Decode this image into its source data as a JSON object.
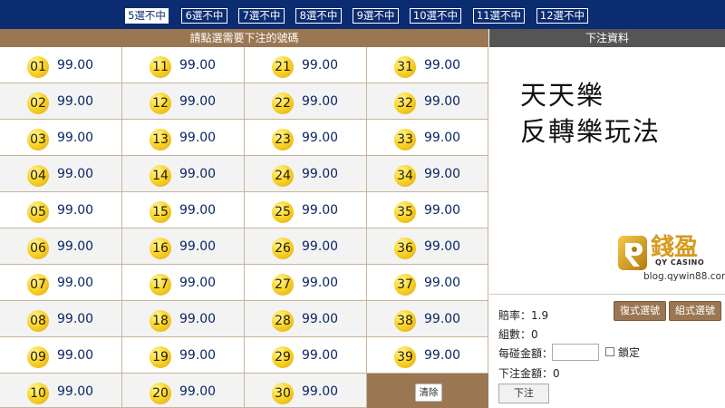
{
  "tabs": [
    {
      "label": "5選不中",
      "active": true
    },
    {
      "label": "6選不中",
      "active": false
    },
    {
      "label": "7選不中",
      "active": false
    },
    {
      "label": "8選不中",
      "active": false
    },
    {
      "label": "9選不中",
      "active": false
    },
    {
      "label": "10選不中",
      "active": false
    },
    {
      "label": "11選不中",
      "active": false
    },
    {
      "label": "12選不中",
      "active": false
    }
  ],
  "left_header": "請點選需要下注的號碼",
  "numbers": [
    {
      "num": "01",
      "odds": "99.00"
    },
    {
      "num": "02",
      "odds": "99.00"
    },
    {
      "num": "03",
      "odds": "99.00"
    },
    {
      "num": "04",
      "odds": "99.00"
    },
    {
      "num": "05",
      "odds": "99.00"
    },
    {
      "num": "06",
      "odds": "99.00"
    },
    {
      "num": "07",
      "odds": "99.00"
    },
    {
      "num": "08",
      "odds": "99.00"
    },
    {
      "num": "09",
      "odds": "99.00"
    },
    {
      "num": "10",
      "odds": "99.00"
    },
    {
      "num": "11",
      "odds": "99.00"
    },
    {
      "num": "12",
      "odds": "99.00"
    },
    {
      "num": "13",
      "odds": "99.00"
    },
    {
      "num": "14",
      "odds": "99.00"
    },
    {
      "num": "15",
      "odds": "99.00"
    },
    {
      "num": "16",
      "odds": "99.00"
    },
    {
      "num": "17",
      "odds": "99.00"
    },
    {
      "num": "18",
      "odds": "99.00"
    },
    {
      "num": "19",
      "odds": "99.00"
    },
    {
      "num": "20",
      "odds": "99.00"
    },
    {
      "num": "21",
      "odds": "99.00"
    },
    {
      "num": "22",
      "odds": "99.00"
    },
    {
      "num": "23",
      "odds": "99.00"
    },
    {
      "num": "24",
      "odds": "99.00"
    },
    {
      "num": "25",
      "odds": "99.00"
    },
    {
      "num": "26",
      "odds": "99.00"
    },
    {
      "num": "27",
      "odds": "99.00"
    },
    {
      "num": "28",
      "odds": "99.00"
    },
    {
      "num": "29",
      "odds": "99.00"
    },
    {
      "num": "30",
      "odds": "99.00"
    },
    {
      "num": "31",
      "odds": "99.00"
    },
    {
      "num": "32",
      "odds": "99.00"
    },
    {
      "num": "33",
      "odds": "99.00"
    },
    {
      "num": "34",
      "odds": "99.00"
    },
    {
      "num": "35",
      "odds": "99.00"
    },
    {
      "num": "36",
      "odds": "99.00"
    },
    {
      "num": "37",
      "odds": "99.00"
    },
    {
      "num": "38",
      "odds": "99.00"
    },
    {
      "num": "39",
      "odds": "99.00"
    }
  ],
  "clear_label": "清除",
  "right_header": "下注資料",
  "overlay": {
    "line1": "天天樂",
    "line2": "反轉樂玩法"
  },
  "logo": {
    "title": "錢盈",
    "subtitle": "QY CASINO",
    "url": "blog.qywin88.com"
  },
  "bet": {
    "odds_label": "賠率：",
    "odds_value": "1.9",
    "groups_label": "組數：",
    "groups_value": "0",
    "amount_label": "每碰金額：",
    "lock_label": "鎖定",
    "total_label": "下注金額：",
    "total_value": "0",
    "submit_label": "下注",
    "multi_label": "復式選號",
    "combo_label": "組式選號"
  },
  "colors": {
    "nav_bg": "#0c2c72",
    "header_brown": "#9a7752",
    "right_header_bg": "#555555",
    "ball_yellow": "#f9d62a",
    "odds_text": "#0c2565",
    "logo_gold": "#d69b1f"
  }
}
